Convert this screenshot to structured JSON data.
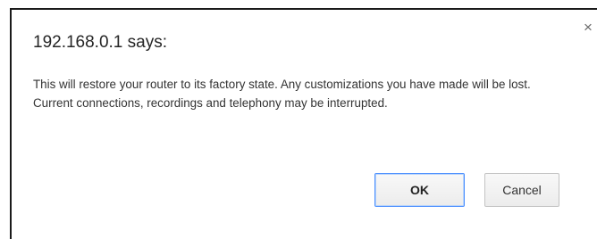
{
  "dialog": {
    "title": "192.168.0.1 says:",
    "close_glyph": "×",
    "message": "This will restore your router to its factory state. Any customizations you have made will be lost. Current connections, recordings and telephony may be interrupted.",
    "ok_label": "OK",
    "cancel_label": "Cancel"
  },
  "icons": {
    "close": "close-icon"
  },
  "colors": {
    "focus_ring": "#4d90fe",
    "frame_border": "#1a1a1a"
  }
}
